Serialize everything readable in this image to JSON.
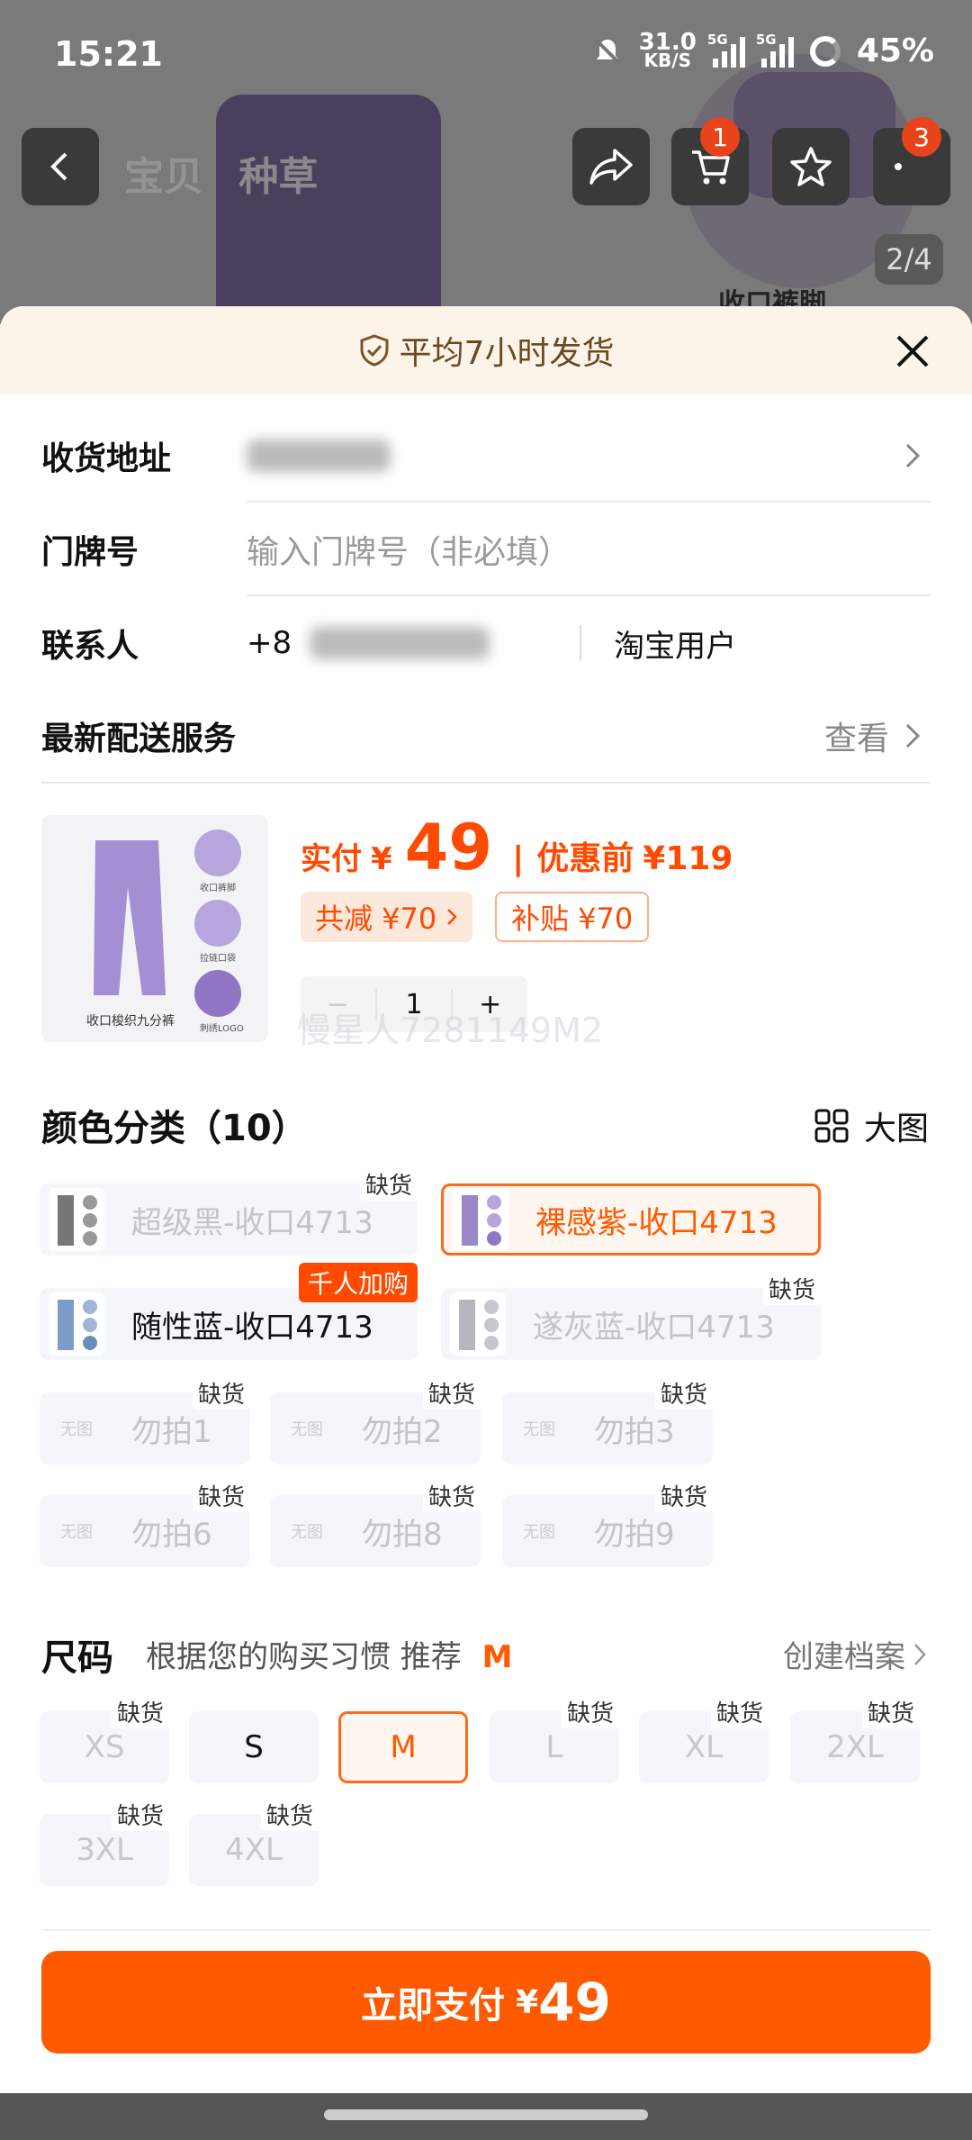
{
  "status_bar": {
    "time": "15:21",
    "net_speed": "31.0",
    "net_unit": "KB/S",
    "sig1": "5G",
    "sig2": "5G",
    "battery": "45%"
  },
  "background": {
    "tabs": [
      "宝贝",
      "种草"
    ],
    "cart_count": "1",
    "more_count": "3",
    "pager": "2/4",
    "caption": "收口裤脚"
  },
  "banner": {
    "text": "平均7小时发货"
  },
  "form": {
    "address_label": "收货地址",
    "door_label": "门牌号",
    "door_placeholder": "输入门牌号（非必填）",
    "contact_label": "联系人",
    "contact_prefix": "+8",
    "contact_name": "淘宝用户",
    "delivery_label": "最新配送服务",
    "delivery_action": "查看"
  },
  "product": {
    "thumb_caption": "收口梭织九分裤",
    "thumb_notes": [
      "收口裤脚",
      "拉链口袋",
      "刺绣LOGO"
    ],
    "pay_label": "实付",
    "currency": "¥",
    "price": "49",
    "original_label": "优惠前",
    "original_price": "¥119",
    "discount_tag": "共减 ¥70",
    "subsidy_tag": "补贴 ¥70",
    "qty_minus": "−",
    "qty": "1",
    "qty_plus": "+",
    "watermark": "慢星人7281149M2"
  },
  "colors": {
    "title": "颜色分类（10）",
    "view_large": "大图",
    "stock_out": "缺货",
    "hot_badge": "千人加购",
    "no_image": "无图",
    "items": [
      {
        "label": "超级黑-收口4713",
        "state": "disabled",
        "oos": true,
        "color": "#6b6b6b"
      },
      {
        "label": "裸感紫-收口4713",
        "state": "selected",
        "oos": false,
        "color": "#9a86c8"
      },
      {
        "label": "随性蓝-收口4713",
        "state": "normal",
        "oos": false,
        "hot": true,
        "color": "#7b9cc9"
      },
      {
        "label": "遂灰蓝-收口4713",
        "state": "disabled",
        "oos": true,
        "color": "#9aa0a8"
      },
      {
        "label": "勿拍1",
        "state": "disabled",
        "oos": true
      },
      {
        "label": "勿拍2",
        "state": "disabled",
        "oos": true
      },
      {
        "label": "勿拍3",
        "state": "disabled",
        "oos": true
      },
      {
        "label": "勿拍6",
        "state": "disabled",
        "oos": true
      },
      {
        "label": "勿拍8",
        "state": "disabled",
        "oos": true
      },
      {
        "label": "勿拍9",
        "state": "disabled",
        "oos": true
      }
    ]
  },
  "sizes": {
    "title": "尺码",
    "hint": "根据您的购买习惯 推荐",
    "recommended": "M",
    "profile_action": "创建档案",
    "items": [
      {
        "label": "XS",
        "state": "disabled"
      },
      {
        "label": "S",
        "state": "normal"
      },
      {
        "label": "M",
        "state": "selected"
      },
      {
        "label": "L",
        "state": "disabled"
      },
      {
        "label": "XL",
        "state": "disabled"
      },
      {
        "label": "2XL",
        "state": "disabled"
      },
      {
        "label": "3XL",
        "state": "disabled"
      },
      {
        "label": "4XL",
        "state": "disabled"
      }
    ]
  },
  "pay_button": {
    "label": "立即支付",
    "currency": "¥",
    "amount": "49"
  },
  "colors_theme": {
    "accent": "#ff5a00",
    "oos_badge_bg": "#ffffff",
    "hot_badge_bg": "#ff4a00"
  }
}
